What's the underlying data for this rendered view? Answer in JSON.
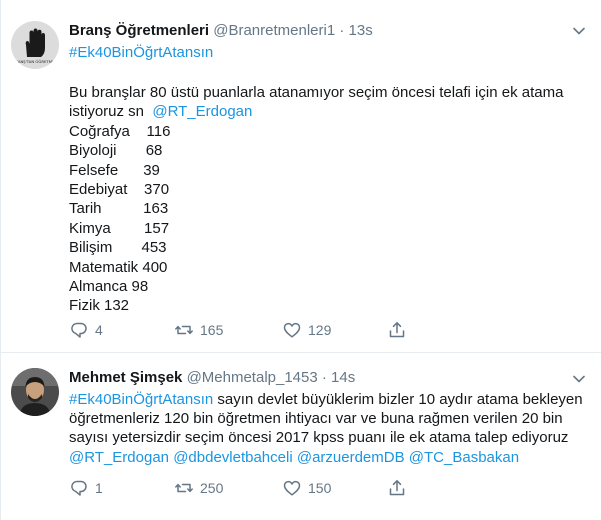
{
  "tweets": [
    {
      "author_name": "Branş Öğretmenleri",
      "handle": "@Branretmenleri1",
      "dot": "·",
      "time": "13s",
      "avatar_text": "BRANŞ'TAN ÖĞRETMEN",
      "hashtag": "#Ek40BinÖğrtAtansın",
      "text_intro": "Bu branşlar 80 üstü puanlarla atanamıyor seçim öncesi telafi için ek atama\nistiyoruz sn  ",
      "mention": "@RT_Erdogan",
      "text_list": "\nCoğrafya    116\nBiyoloji       68\nFelsefe      39\nEdebiyat    370\nTarih          163\nKimya        157\nBilişim       453\nMatematik 400\nAlmanca 98\nFizik 132",
      "replies": "4",
      "retweets": "165",
      "likes": "129"
    },
    {
      "author_name": "Mehmet Şimşek",
      "handle": "@Mehmetalp_1453",
      "dot": "·",
      "time": "14s",
      "hashtag": "#Ek40BinÖğrtAtansın",
      "text": " sayın devlet büyüklerim bizler 10 aydır atama bekleyen öğretmenleriz 120 bin öğretmen ihtiyacı var ve buna rağmen verilen 20 bin sayısı yetersizdir seçim öncesi 2017 kpss puanı ile ek atama talep ediyoruz",
      "mentions": [
        "@RT_Erdogan",
        "@dbdevletbahceli",
        "@arzuerdemDB",
        "@TC_Basbakan"
      ],
      "replies": "1",
      "retweets": "250",
      "likes": "150"
    }
  ],
  "icons": {
    "reply": "reply-icon",
    "retweet": "retweet-icon",
    "like": "heart-icon",
    "share": "share-icon",
    "caret": "chevron-down-icon"
  },
  "colors": {
    "link": "#1b95e0",
    "secondary": "#657786",
    "divider": "#e6ecf0",
    "text": "#14171a"
  }
}
